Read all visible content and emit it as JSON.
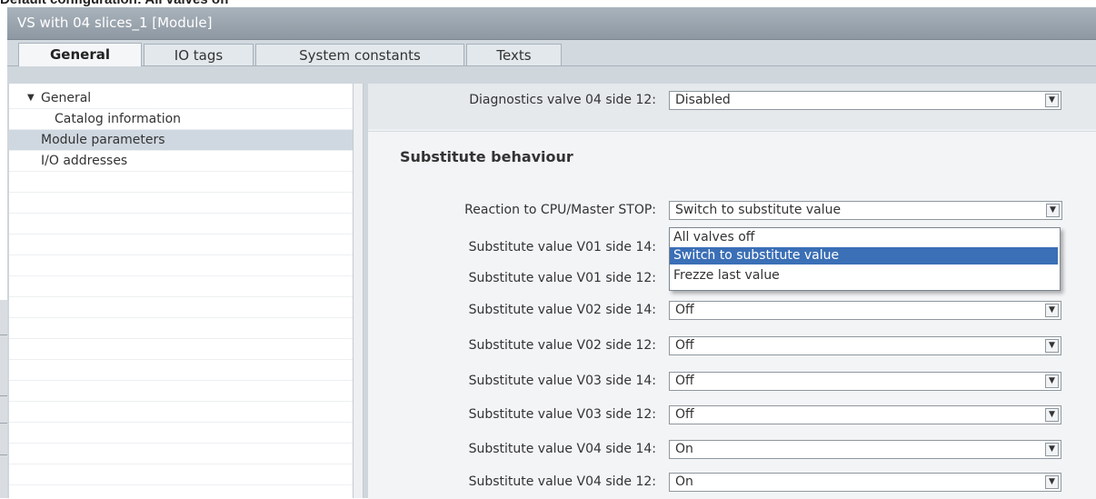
{
  "caption": "Default configuration: All valves off",
  "window": {
    "title": "VS with 04 slices_1 [Module]"
  },
  "tabs": [
    "General",
    "IO tags",
    "System constants",
    "Texts"
  ],
  "nav": {
    "items": [
      "General",
      "Catalog information",
      "Module parameters",
      "I/O addresses"
    ],
    "expand_icon": "triangle-down-icon",
    "selected": "Module parameters"
  },
  "params": {
    "top_row": {
      "label": "Diagnostics valve 04 side 12:",
      "value": "Disabled"
    },
    "section_title": "Substitute behaviour",
    "reaction": {
      "label": "Reaction to CPU/Master STOP:",
      "value": "Switch to substitute value"
    },
    "dropdown_options": [
      "All valves off",
      "Switch to substitute value",
      "Frezze last value"
    ],
    "dropdown_selected": "Switch to substitute value",
    "hidden_rows": [
      {
        "label": "Substitute value V01 side 14:"
      },
      {
        "label": "Substitute value V01 side 12:"
      }
    ],
    "rows": [
      {
        "label": "Substitute value V02 side 14:",
        "value": "Off"
      },
      {
        "label": "Substitute value V02 side 12:",
        "value": "Off"
      },
      {
        "label": "Substitute value V03 side 14:",
        "value": "Off"
      },
      {
        "label": "Substitute value V03 side 12:",
        "value": "Off"
      },
      {
        "label": "Substitute value V04 side 14:",
        "value": "On"
      },
      {
        "label": "Substitute value V04 side 12:",
        "value": "On"
      }
    ],
    "dropdown_arrow_icon": "dropdown-arrow-icon"
  },
  "colors": {
    "selection": "#3b6fb6",
    "nav_selected": "#cfd8e1",
    "titlebar": "#98a2ac"
  }
}
